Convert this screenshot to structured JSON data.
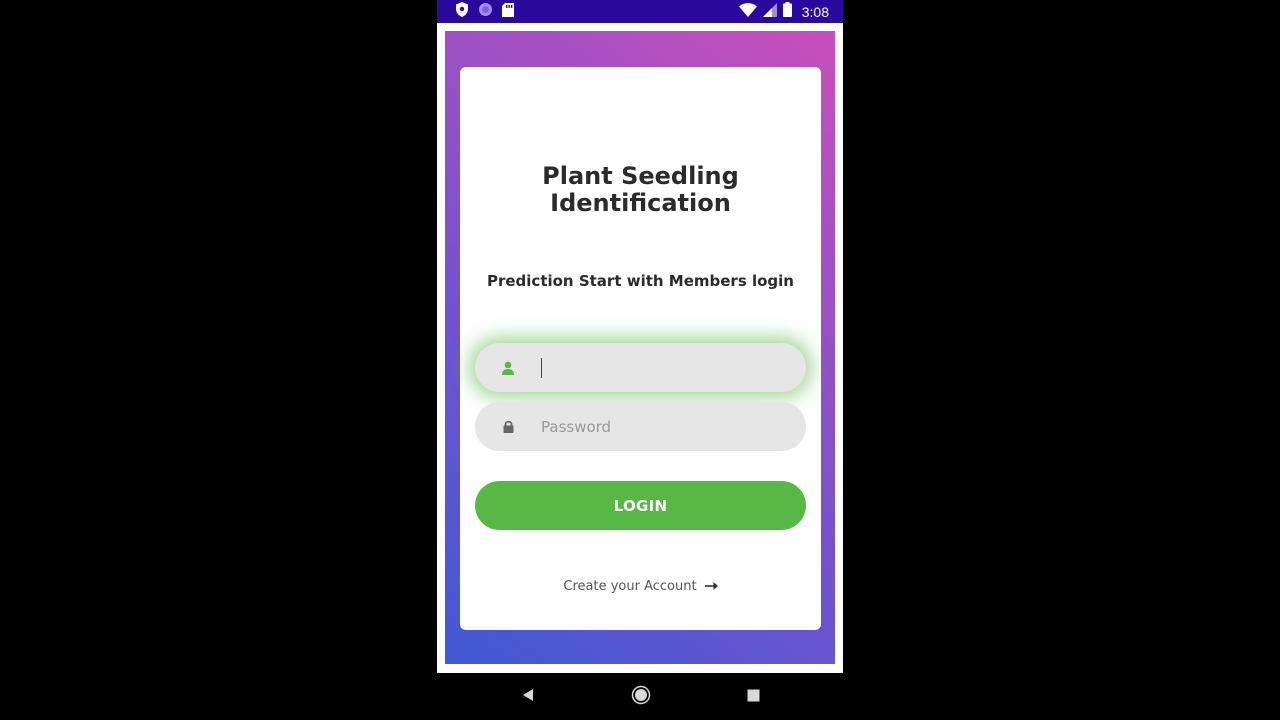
{
  "status_bar": {
    "time": "3:08",
    "icons": [
      "shield-icon",
      "circle-icon",
      "sd-card-icon",
      "wifi-icon",
      "signal-icon",
      "battery-icon"
    ]
  },
  "login_card": {
    "title_line1": "Plant Seedling",
    "title_line2": "Identification",
    "subtitle": "Prediction Start with Members login",
    "username": {
      "value": "",
      "placeholder": "",
      "icon": "user-icon"
    },
    "password": {
      "value": "",
      "placeholder": "Password",
      "icon": "lock-icon"
    },
    "login_label": "LOGIN",
    "create_account_label": "Create your Account",
    "create_account_icon": "arrow-right-icon"
  },
  "colors": {
    "accent_green": "#57b846",
    "status_bar": "#2a0a9e",
    "gradient_start": "#3f5ad4",
    "gradient_end": "#c84fbb"
  },
  "nav_bar": {
    "icons": [
      "back-icon",
      "home-icon",
      "recents-icon"
    ]
  }
}
